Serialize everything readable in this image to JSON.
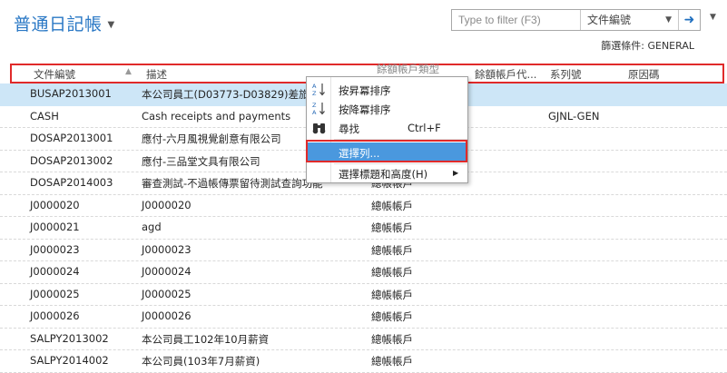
{
  "page": {
    "title": "普通日記帳"
  },
  "filter": {
    "placeholder": "Type to filter (F3)",
    "field": "文件編號",
    "go_icon": "arrow-right-icon",
    "summary": "篩選條件: GENERAL"
  },
  "columns": [
    {
      "label": "文件編號",
      "sorted": "ascending"
    },
    {
      "label": "描述"
    },
    {
      "label": "餘額帳戶類型"
    },
    {
      "label": "餘額帳戶代..."
    },
    {
      "label": "系列號"
    },
    {
      "label": "原因碼"
    }
  ],
  "rows": [
    {
      "code": "BUSAP2013001",
      "desc": "本公司員工(D03773-D03829)差旅",
      "acct": "",
      "series": "",
      "selected": true
    },
    {
      "code": "CASH",
      "desc": "Cash receipts and payments",
      "acct": "",
      "series": "GJNL-GEN"
    },
    {
      "code": "DOSAP2013001",
      "desc": "應付-六月風視覺創意有限公司",
      "acct": "",
      "series": ""
    },
    {
      "code": "DOSAP2013002",
      "desc": "應付-三品堂文具有限公司",
      "acct": "",
      "series": ""
    },
    {
      "code": "DOSAP2014003",
      "desc": "審查測試-不過帳傳票留待測試查詢功能",
      "acct": "總帳帳戶",
      "series": ""
    },
    {
      "code": "J0000020",
      "desc": "J0000020",
      "acct": "總帳帳戶",
      "series": ""
    },
    {
      "code": "J0000021",
      "desc": "agd",
      "acct": "總帳帳戶",
      "series": ""
    },
    {
      "code": "J0000023",
      "desc": "J0000023",
      "acct": "總帳帳戶",
      "series": ""
    },
    {
      "code": "J0000024",
      "desc": "J0000024",
      "acct": "總帳帳戶",
      "series": ""
    },
    {
      "code": "J0000025",
      "desc": "J0000025",
      "acct": "總帳帳戶",
      "series": ""
    },
    {
      "code": "J0000026",
      "desc": "J0000026",
      "acct": "總帳帳戶",
      "series": ""
    },
    {
      "code": "SALPY2013002",
      "desc": "本公司員工102年10月薪資",
      "acct": "總帳帳戶",
      "series": ""
    },
    {
      "code": "SALPY2014002",
      "desc": "本公司員(103年7月薪資)",
      "acct": "總帳帳戶",
      "series": ""
    }
  ],
  "context_menu": {
    "items": [
      {
        "label": "按昇冪排序",
        "icon": "sort-ascending-icon"
      },
      {
        "label": "按降冪排序",
        "icon": "sort-descending-icon"
      },
      {
        "label": "尋找",
        "shortcut": "Ctrl+F",
        "icon": "binoculars-icon"
      },
      {
        "label": "選擇列...",
        "highlighted": true
      },
      {
        "label": "選擇標題和高度(H)",
        "submenu": true
      }
    ]
  },
  "colors": {
    "accent": "#2a78c5",
    "selection": "#cde6f7",
    "menu_highlight": "#4a98de",
    "annotation_red": "#e02a2a"
  }
}
